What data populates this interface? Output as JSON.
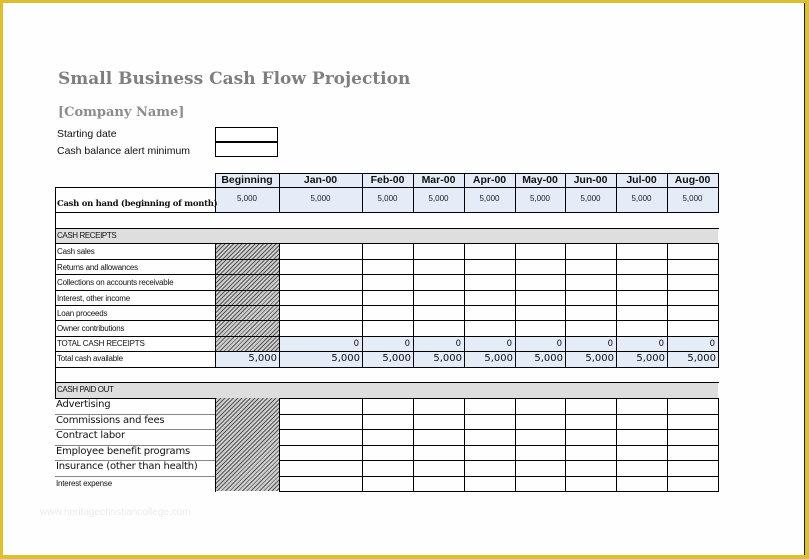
{
  "document": {
    "title": "Small Business Cash Flow Projection",
    "company_name": "[Company Name]",
    "starting_date_label": "Starting date",
    "starting_date_value": "",
    "alert_minimum_label": "Cash balance alert minimum",
    "alert_minimum_value": "",
    "watermark": "www.heritagechristiancollege.com"
  },
  "table": {
    "columns": [
      "Beginning",
      "Jan-00",
      "Feb-00",
      "Mar-00",
      "Apr-00",
      "May-00",
      "Jun-00",
      "Jul-00",
      "Aug-00"
    ],
    "cash_on_hand": {
      "label": "Cash on hand (beginning of month)",
      "values": [
        "5,000",
        "5,000",
        "5,000",
        "5,000",
        "5,000",
        "5,000",
        "5,000",
        "5,000",
        "5,000"
      ]
    },
    "receipts": {
      "header": "CASH RECEIPTS",
      "rows": [
        {
          "label": "Cash sales"
        },
        {
          "label": "Returns and allowances"
        },
        {
          "label": "Collections on accounts receivable"
        },
        {
          "label": "Interest, other income"
        },
        {
          "label": "Loan proceeds"
        },
        {
          "label": "Owner contributions"
        }
      ],
      "total_label": "TOTAL CASH RECEIPTS",
      "total_values": [
        "",
        "0",
        "0",
        "0",
        "0",
        "0",
        "0",
        "0",
        "0"
      ],
      "available_label": "Total cash available",
      "available_values": [
        "5,000",
        "5,000",
        "5,000",
        "5,000",
        "5,000",
        "5,000",
        "5,000",
        "5,000",
        "5,000"
      ]
    },
    "paid_out": {
      "header": "CASH PAID OUT",
      "rows": [
        {
          "label": "Advertising"
        },
        {
          "label": "Commissions and fees"
        },
        {
          "label": "Contract labor"
        },
        {
          "label": "Employee benefit programs"
        },
        {
          "label": "Insurance (other than health)"
        },
        {
          "label": "Interest expense"
        }
      ]
    }
  },
  "colors": {
    "frame": "#dcc032",
    "title": "#7f7f7f",
    "band": "#dedede",
    "total_fill": "#e3ecf7"
  }
}
